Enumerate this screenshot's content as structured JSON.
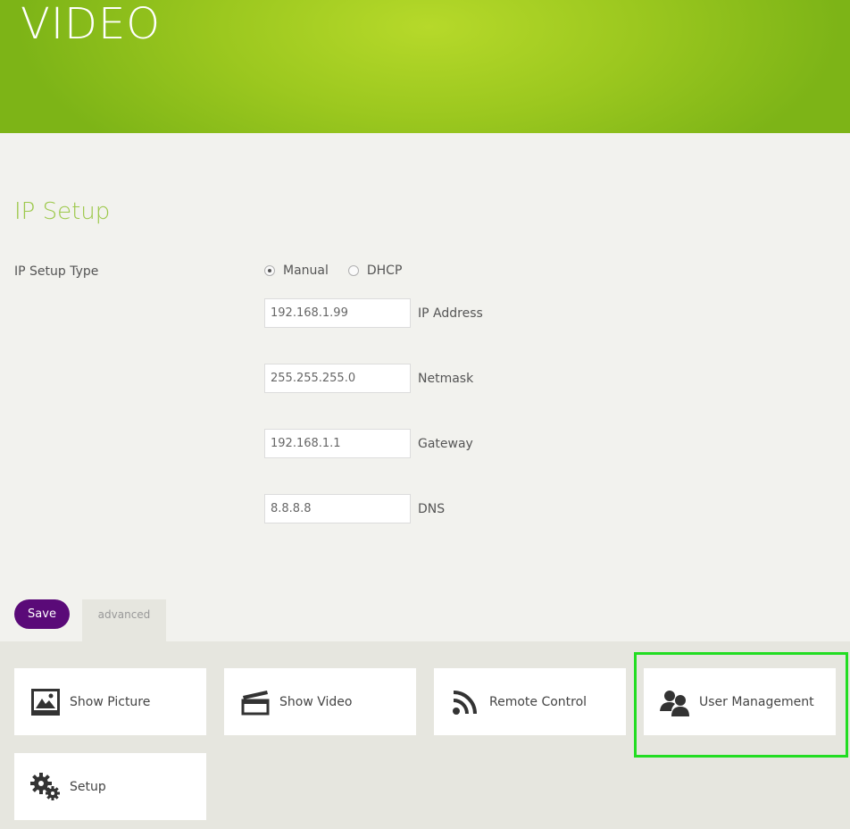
{
  "header": {
    "title": "VIDEO"
  },
  "ip_setup": {
    "title": "IP Setup",
    "type_label": "IP Setup Type",
    "options": [
      {
        "label": "Manual",
        "checked": true
      },
      {
        "label": "DHCP",
        "checked": false
      }
    ],
    "fields": [
      {
        "value": "192.168.1.99",
        "label": "IP Address"
      },
      {
        "value": "255.255.255.0",
        "label": "Netmask"
      },
      {
        "value": "192.168.1.1",
        "label": "Gateway"
      },
      {
        "value": "8.8.8.8",
        "label": "DNS"
      }
    ],
    "save_label": "Save",
    "advanced_label": "advanced"
  },
  "nav": {
    "tiles": [
      {
        "label": "Show Picture",
        "icon": "picture-icon"
      },
      {
        "label": "Show Video",
        "icon": "clapperboard-icon"
      },
      {
        "label": "Remote Control",
        "icon": "rss-icon"
      },
      {
        "label": "User Management",
        "icon": "users-icon"
      },
      {
        "label": "Setup",
        "icon": "gears-icon"
      }
    ],
    "highlight_color": "#22dd22"
  },
  "colors": {
    "header_green": "#8fc11c",
    "accent_title": "#9cc84a",
    "save_purple": "#5a0a78"
  }
}
